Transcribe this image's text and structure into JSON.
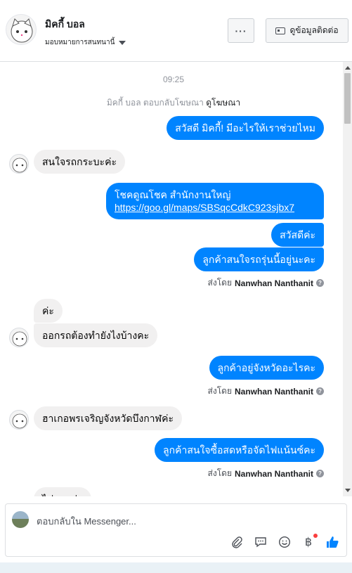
{
  "header": {
    "name": "มิคกี้ บอล",
    "assign_label": "มอบหมายการสนทนานี้",
    "more_label": "···",
    "contact_label": "ดูข้อมูลติดต่อ"
  },
  "conversation": {
    "timestamp": "09:25",
    "notice_prefix": "มิคกี้ บอล ตอบกลับโฆษณา",
    "notice_link": "ดูโฆษณา",
    "messages": {
      "m1": "สวัสดี มิคกี้! มีอะไรให้เราช่วยไหม",
      "m2": "สนใจรถกระบะค่ะ",
      "m3_line1": "โชคดูณโชค สำนักงานใหญ่",
      "m3_link": "https://goo.gl/maps/SBSqcCdkC923sjbx7",
      "m4": "สวัสดีค่ะ",
      "m5": "ลูกค้าสนใจรถรุ่นนี้อยู่นะคะ",
      "m6": "ค่ะ",
      "m7": "ออกรถต้องทำยังไงบ้างคะ",
      "m8": "ลูกค้าอยู่จังหวัดอะไรคะ",
      "m9": "ฮาเกอพรเจริญจังหวัดบึงกาฬค่ะ",
      "m10": "ลูกค้าสนใจซื้อสดหรือจัดไฟแน้นซ์คะ",
      "m11": "ไม่มากจ่ะ"
    },
    "sent_by_prefix": "ส่งโดย",
    "sender": "Nanwhan Nanthanit"
  },
  "composer": {
    "placeholder": "ตอบกลับใน Messenger..."
  },
  "icons": {
    "attach": "paperclip-icon",
    "saved_replies": "chat-bubble-icon",
    "emoji": "smile-icon",
    "currency": "baht-icon",
    "like": "thumbs-up-icon"
  },
  "colors": {
    "outgoing_bubble": "#0084ff",
    "incoming_bubble": "#f1f0f0",
    "like": "#0084ff"
  }
}
